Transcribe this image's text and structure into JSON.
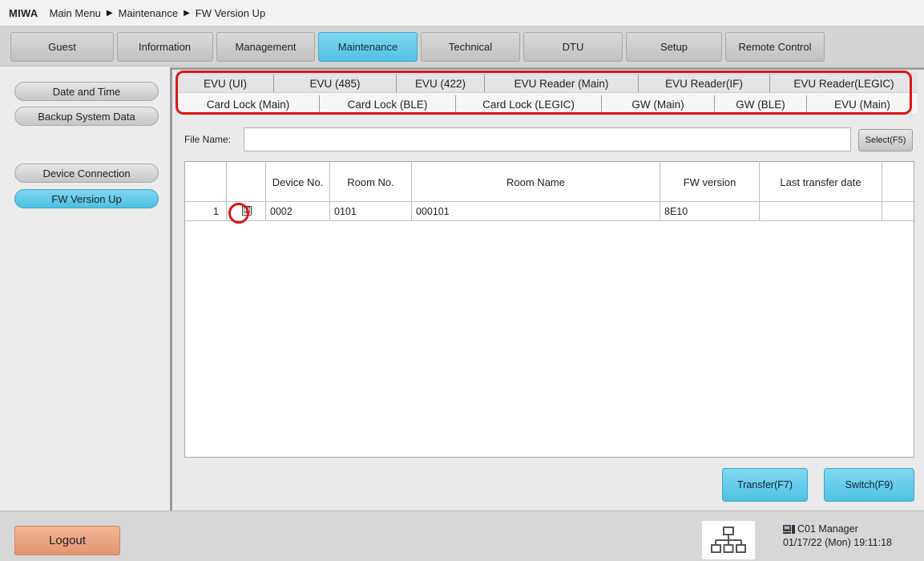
{
  "titlebar": {
    "brand": "MIWA",
    "breadcrumb": [
      "Main Menu",
      "Maintenance",
      "FW Version Up"
    ]
  },
  "menu": {
    "items": [
      "Guest",
      "Information",
      "Management",
      "Maintenance",
      "Technical",
      "DTU",
      "Setup",
      "Remote Control"
    ],
    "active": "Maintenance"
  },
  "leftnav": {
    "items": [
      "Date and Time",
      "Backup System Data",
      "Device Connection",
      "FW Version Up"
    ],
    "active": "FW Version Up"
  },
  "subtabs": {
    "row1": [
      "EVU (UI)",
      "EVU (485)",
      "EVU (422)",
      "EVU Reader (Main)",
      "EVU Reader(IF)",
      "EVU Reader(LEGIC)"
    ],
    "row2": [
      "Card Lock (Main)",
      "Card Lock (BLE)",
      "Card Lock (LEGIC)",
      "GW (Main)",
      "GW (BLE)",
      "EVU (Main)"
    ],
    "active": "Card Lock (Main)"
  },
  "file": {
    "label": "File Name:",
    "value": "",
    "select_label": "Select(F5)"
  },
  "table": {
    "columns": [
      "",
      "",
      "Device No.",
      "Room No.",
      "Room Name",
      "FW version",
      "Last transfer date"
    ],
    "rows": [
      {
        "index": "1",
        "checked": true,
        "check_glyph": "☑",
        "device_no": "0002",
        "room_no": "0101",
        "room_name": "000101",
        "fw_version": "8E10",
        "last_transfer": ""
      }
    ]
  },
  "actions": {
    "transfer_label": "Transfer(F7)",
    "switch_label": "Switch(F9)"
  },
  "footer": {
    "logout_label": "Logout",
    "user": "C01 Manager",
    "datetime": "01/17/22 (Mon) 19:11:18",
    "network_icon": "network-icon",
    "terminal_icon": "pc-icon"
  },
  "colors": {
    "accent": "#5cc7e7",
    "logout": "#eba27f",
    "highlight": "#e01414"
  }
}
